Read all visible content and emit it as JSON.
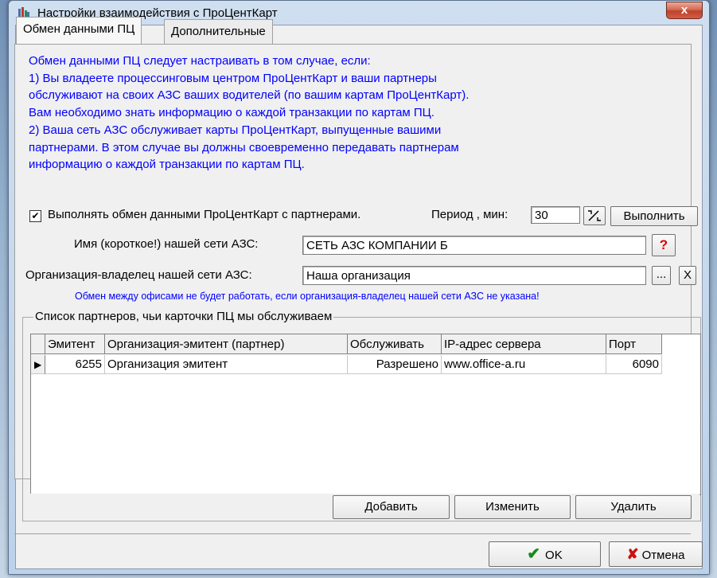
{
  "window": {
    "title": "Настройки взаимодействия с ПроЦентКарт",
    "close_glyph": "x"
  },
  "tabs": [
    {
      "label": "Обмен данными ПЦ"
    },
    {
      "label": "Дополнительные"
    }
  ],
  "info_lines": [
    "Обмен данными ПЦ следует настраивать в том случае, если:",
    "1) Вы владеете процессинговым центром ПроЦентКарт и ваши партнеры",
    "обслуживают на своих АЗС ваших водителей (по вашим картам ПроЦентКарт).",
    "Вам необходимо знать информацию о каждой транзакции по картам ПЦ.",
    "2) Ваша сеть АЗС обслуживает карты ПроЦентКарт, выпущенные вашими",
    "партнерами. В этом случае вы должны своевременно передавать партнерам",
    "информацию о каждой транзакции по картам ПЦ."
  ],
  "exchange": {
    "checkbox_checked": true,
    "checkbox_mark": "✔",
    "checkbox_label": "Выполнять обмен данными ПроЦентКарт с партнерами.",
    "period_label": "Период , мин:",
    "period_value": "30",
    "run_button": "Выполнить"
  },
  "network_name": {
    "label": "Имя (короткое!) нашей сети АЗС:",
    "value": "СЕТЬ АЗС КОМПАНИИ Б",
    "help_button": "?"
  },
  "owner_org": {
    "label": "Организация-владелец нашей сети АЗС:",
    "value": "Наша организация",
    "browse_button": "...",
    "clear_button": "X"
  },
  "warning": "Обмен между офисами не будет работать, если организация-владелец нашей сети АЗС не указана!",
  "partners": {
    "group_title": "Список партнеров, чьи карточки ПЦ мы обслуживаем",
    "columns": [
      "Эмитент",
      "Организация-эмитент (партнер)",
      "Обслуживать",
      "IP-адрес сервера",
      "Порт"
    ],
    "rows": [
      {
        "indicator": "▶",
        "issuer": "6255",
        "organization": "Организация эмитент",
        "serve": "Разрешено",
        "ip": "www.office-a.ru",
        "port": "6090"
      }
    ],
    "buttons": {
      "add": "Добавить",
      "edit": "Изменить",
      "delete": "Удалить"
    }
  },
  "footer": {
    "ok": "OK",
    "ok_icon": "✔",
    "cancel": "Отмена",
    "cancel_icon": "✘"
  },
  "colors": {
    "info_text": "#0000ff",
    "help_red": "#e00000",
    "ok_green": "#1a8a1a",
    "cancel_red": "#cc1010"
  }
}
